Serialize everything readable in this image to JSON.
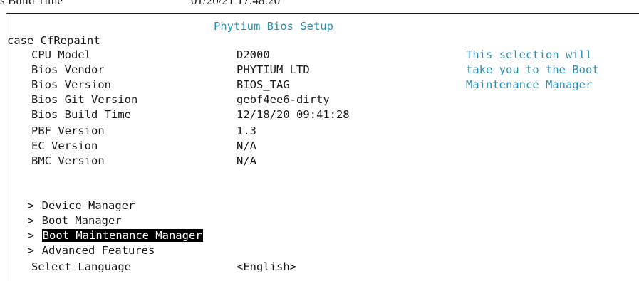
{
  "header_cut_text": "s Build Time",
  "header_cut_value": "01/20/21 17:48:20",
  "title": "Phytium Bios Setup",
  "case_label": "case CfRepaint",
  "info": [
    {
      "label": "CPU Model",
      "value": "D2000"
    },
    {
      "label": "Bios Vendor",
      "value": "PHYTIUM LTD"
    },
    {
      "label": "Bios Version",
      "value": "BIOS_TAG"
    },
    {
      "label": "Bios Git Version",
      "value": "gebf4ee6-dirty"
    },
    {
      "label": "Bios Build Time",
      "value": "12/18/20 09:41:28"
    },
    {
      "label": "PBF Version",
      "value": "1.3"
    },
    {
      "label": "EC Version",
      "value": "N/A"
    },
    {
      "label": "BMC Version",
      "value": "N/A"
    }
  ],
  "help_lines": [
    "This selection will",
    "take you to the Boot",
    "Maintenance Manager"
  ],
  "menu_marker": ">",
  "menu": [
    {
      "label": "Device Manager",
      "selected": false
    },
    {
      "label": "Boot Manager",
      "selected": false
    },
    {
      "label": "Boot Maintenance Manager",
      "selected": true
    },
    {
      "label": "Advanced Features",
      "selected": false
    }
  ],
  "language": {
    "label": "Select Language",
    "value": "<English>"
  },
  "colors": {
    "title": "#2a8fb3",
    "help": "#2a8fb3",
    "selection_bg": "#000000",
    "selection_fg": "#ffffff"
  }
}
